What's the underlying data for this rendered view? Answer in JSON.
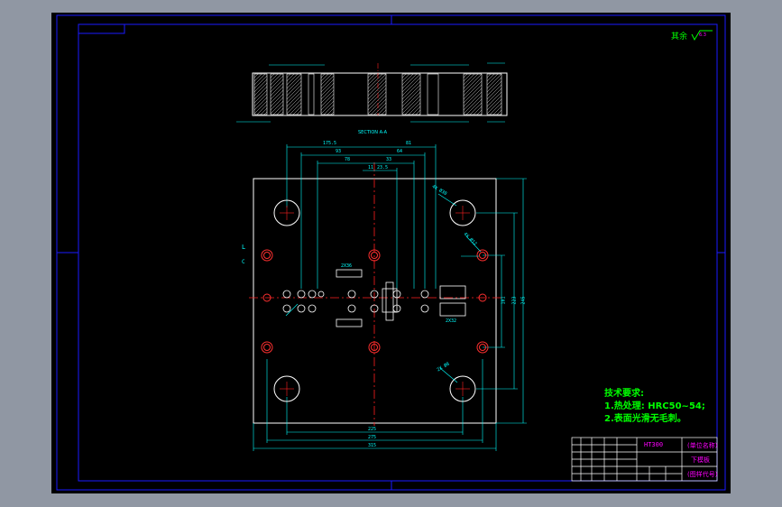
{
  "colors": {
    "frame": "#1a1aff",
    "outline": "#ffffff",
    "dimension": "#00ffff",
    "center_line": "#ff2020",
    "hole": "#ff3030",
    "text_green": "#00ff00",
    "text_magenta": "#ff00ff",
    "title_block": "#ffffff",
    "background": "#000000"
  },
  "drawing": {
    "roughness_note": "其余",
    "roughness_value": "6.3",
    "section_label": "SECTION A-A",
    "side_marker_left": "L",
    "side_marker_c": "C",
    "technical_requirements": {
      "title": "技术要求:",
      "items": [
        "1.热处理: HRC50~54;",
        "2.表面光滑无毛刺。"
      ]
    },
    "dimensions_top": [
      "175.5",
      "81",
      "93",
      "64",
      "78",
      "33",
      "11",
      "23.5"
    ],
    "dimensions_bottom": [
      "225",
      "275",
      "315"
    ],
    "dimensions_right": [
      "101",
      "223",
      "245"
    ],
    "pocket_labels": [
      "2X36",
      "2X32"
    ],
    "hole_callouts": [
      "4X Ø30",
      "4X Ø12",
      "2X Ø8"
    ]
  },
  "title_block": {
    "material": "HT300",
    "part_name": "下模板",
    "drawing_no_label": "(图样代号)",
    "material_label": "(单位名称)"
  }
}
